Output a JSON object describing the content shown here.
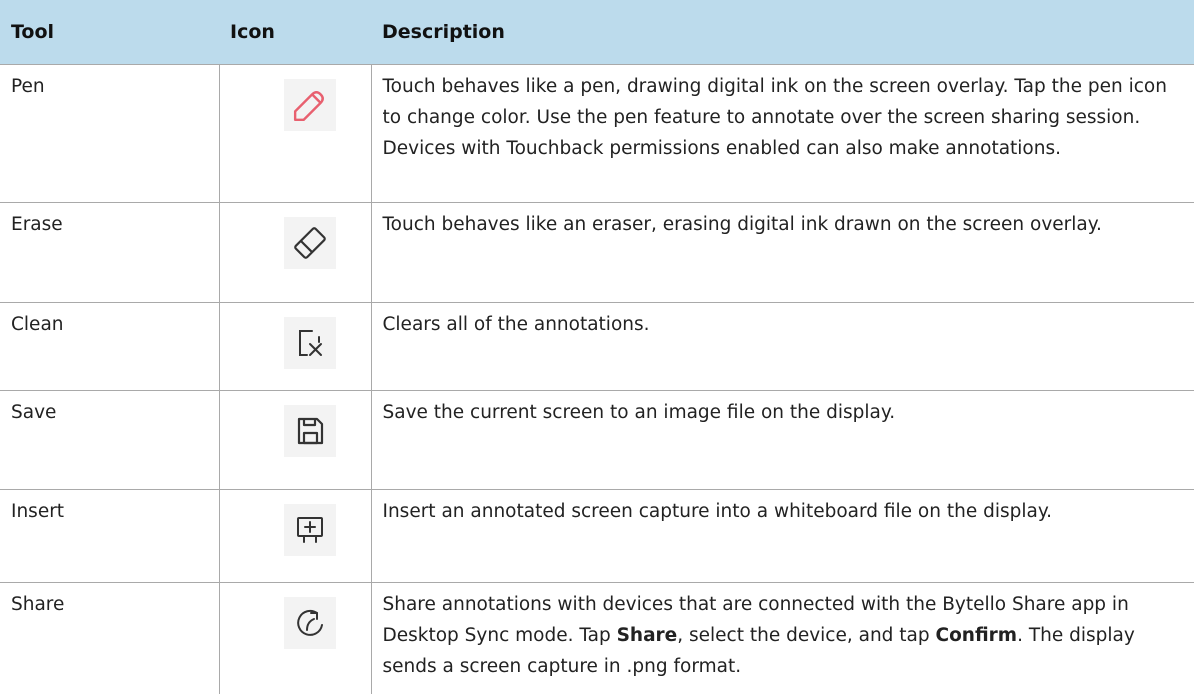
{
  "table": {
    "headers": {
      "tool": "Tool",
      "icon": "Icon",
      "description": "Description"
    },
    "rows": [
      {
        "tool": "Pen",
        "icon": "pen-icon",
        "icon_color": "#e8606f",
        "description": "Touch behaves like a pen, drawing digital ink on the screen overlay. Tap the pen icon to change color. Use the pen feature to annotate over the screen sharing session. Devices with Touchback permissions enabled can also make annotations."
      },
      {
        "tool": "Erase",
        "icon": "eraser-icon",
        "description": "Touch behaves like an eraser, erasing digital ink drawn on the screen overlay."
      },
      {
        "tool": "Clean",
        "icon": "clean-icon",
        "description": "Clears all of the annotations."
      },
      {
        "tool": "Save",
        "icon": "save-icon",
        "description": "Save the current screen to an image file on the display."
      },
      {
        "tool": "Insert",
        "icon": "insert-whiteboard-icon",
        "description": "Insert an annotated screen capture into a whiteboard file on the display."
      },
      {
        "tool": "Share",
        "icon": "share-icon",
        "description_parts": {
          "p1": "Share annotations with devices that are connected with the Bytello Share app in Desktop Sync mode. Tap ",
          "b1": "Share",
          "p2": ", select the device, and tap ",
          "b2": "Confirm",
          "p3": ". The display sends a screen capture in .png format."
        }
      }
    ]
  },
  "colors": {
    "header_background": "#bcdbec",
    "border": "#a9a9a9",
    "icon_tile": "#f3f3f3",
    "pen_icon": "#e8606f",
    "icon_stroke": "#333333"
  }
}
